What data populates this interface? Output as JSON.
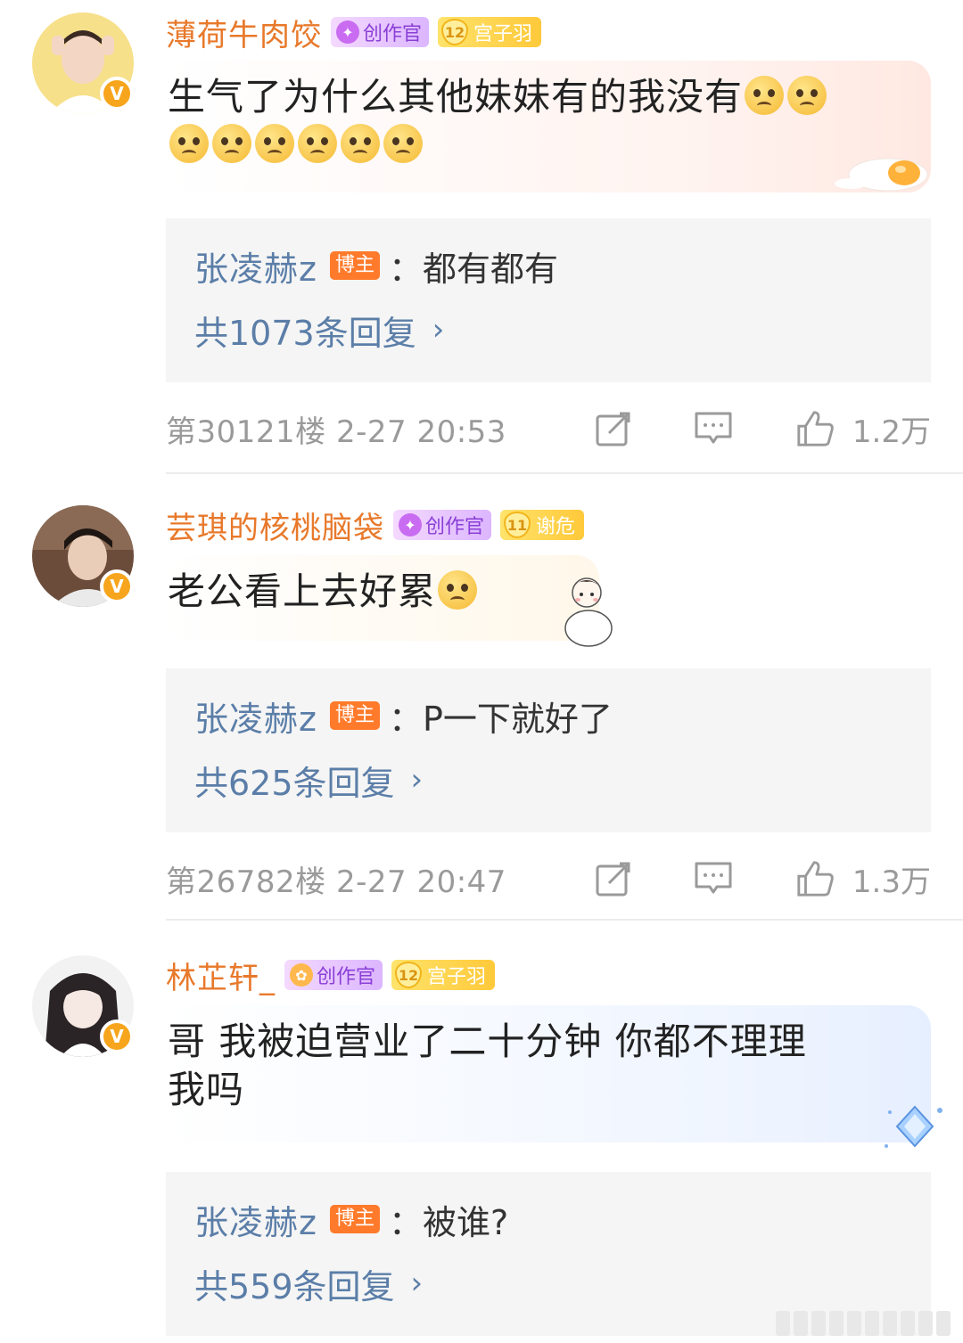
{
  "comments": [
    {
      "username": "薄荷牛肉饺",
      "creator_badge": "创作官",
      "fan_level": "12",
      "fan_group": "宫子羽",
      "verified_mark": "V",
      "text": "生气了为什么其他妹妹有的我没有",
      "emoji_count": 8,
      "reply": {
        "author": "张凌赫z",
        "tag": "博主",
        "text": "：都有都有",
        "count_label": "共1073条回复",
        "chevron": "›"
      },
      "floor_time": "第30121楼 2-27 20:53",
      "likes": "1.2万"
    },
    {
      "username": "芸琪的核桃脑袋",
      "creator_badge": "创作官",
      "fan_level": "11",
      "fan_group": "谢危",
      "verified_mark": "V",
      "text": "老公看上去好累",
      "reply": {
        "author": "张凌赫z",
        "tag": "博主",
        "text": "：P一下就好了",
        "count_label": "共625条回复",
        "chevron": "›"
      },
      "floor_time": "第26782楼 2-27 20:47",
      "likes": "1.3万"
    },
    {
      "username": "林芷轩_",
      "creator_badge": "创作官",
      "fan_level": "12",
      "fan_group": "宫子羽",
      "verified_mark": "V",
      "text_line1": "哥 我被迫营业了二十分钟 你都不理理",
      "text_line2": "我吗",
      "reply": {
        "author": "张凌赫z",
        "tag": "博主",
        "text": "：被谁?",
        "count_label": "共559条回复",
        "chevron": "›"
      }
    }
  ],
  "icons": {
    "repost": "edit-icon",
    "comment": "comment-icon",
    "like": "thumbs-up-icon"
  },
  "colors": {
    "username": "#e8792b",
    "reply_author": "#5b7ea8",
    "blogger_tag": "#ff7a2a",
    "meta": "#9a9a9a",
    "verified": "#f7a51c"
  }
}
